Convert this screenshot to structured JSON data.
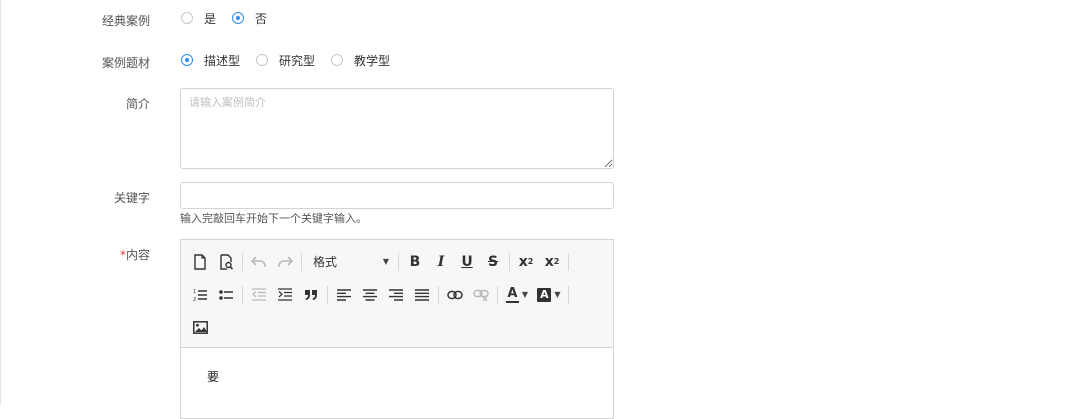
{
  "form": {
    "classic_case": {
      "label": "经典案例",
      "options": [
        {
          "label": "是",
          "checked": false
        },
        {
          "label": "否",
          "checked": true
        }
      ]
    },
    "case_topic": {
      "label": "案例题材",
      "options": [
        {
          "label": "描述型",
          "checked": true
        },
        {
          "label": "研究型",
          "checked": false
        },
        {
          "label": "教学型",
          "checked": false
        }
      ]
    },
    "intro": {
      "label": "简介",
      "placeholder": "请输入案例简介",
      "value": ""
    },
    "keywords": {
      "label": "关键字",
      "value": "",
      "hint": "输入完敲回车开始下一个关键字输入。"
    },
    "content": {
      "required_mark": "*",
      "label": "内容"
    }
  },
  "editor": {
    "format_label": "格式",
    "body_text": "要",
    "toolbar_icons": {
      "row1": [
        "new-document-icon",
        "preview-icon",
        "undo-icon",
        "redo-icon",
        "format-dropdown",
        "bold-icon",
        "italic-icon",
        "underline-icon",
        "strikethrough-icon",
        "subscript-icon",
        "superscript-icon"
      ],
      "row2": [
        "numbered-list-icon",
        "bulleted-list-icon",
        "outdent-icon",
        "indent-icon",
        "blockquote-icon",
        "align-left-icon",
        "align-center-icon",
        "align-right-icon",
        "justify-icon",
        "link-icon",
        "unlink-icon",
        "text-color-icon",
        "background-color-icon"
      ],
      "row3": [
        "image-icon"
      ]
    },
    "glyphs": {
      "bold": "B",
      "italic": "I",
      "underline": "U",
      "strike": "S",
      "sub": "x",
      "sub_index": "2",
      "sup": "x",
      "sup_index": "2",
      "text_color": "A",
      "bg_color": "A"
    }
  },
  "colors": {
    "accent": "#2d8cf0",
    "required": "#e23c3c",
    "border": "#d4d4d4",
    "toolbar_bg": "#f7f7f7"
  }
}
